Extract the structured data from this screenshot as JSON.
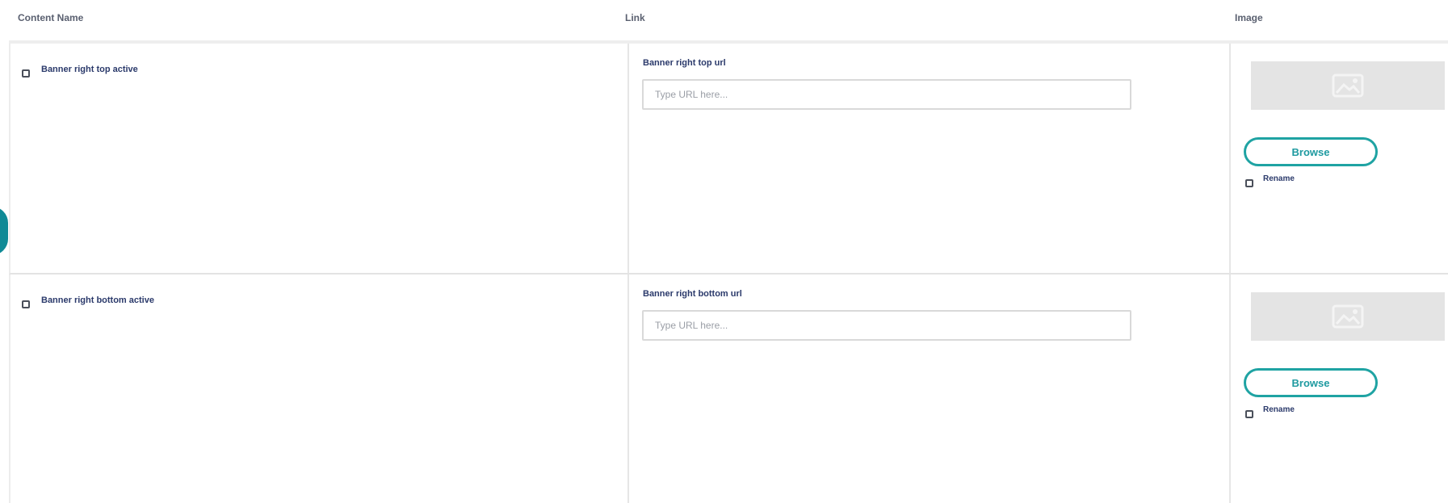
{
  "table": {
    "headers": {
      "content_name": "Content Name",
      "link": "Link",
      "image": "Image"
    },
    "rows": [
      {
        "name_label": "Banner right top active",
        "link_label": "Banner right top url",
        "url_value": "",
        "url_placeholder": "Type URL here...",
        "browse_label": "Browse",
        "rename_label": "Rename"
      },
      {
        "name_label": "Banner right bottom active",
        "link_label": "Banner right bottom url",
        "url_value": "",
        "url_placeholder": "Type URL here...",
        "browse_label": "Browse",
        "rename_label": "Rename"
      }
    ]
  },
  "icons": {
    "image_placeholder": "image-icon"
  },
  "colors": {
    "accent": "#1fa3a3",
    "side_tab": "#0f8a96",
    "label_text": "#2b3a6b",
    "placeholder_bg": "#e4e4e4"
  }
}
